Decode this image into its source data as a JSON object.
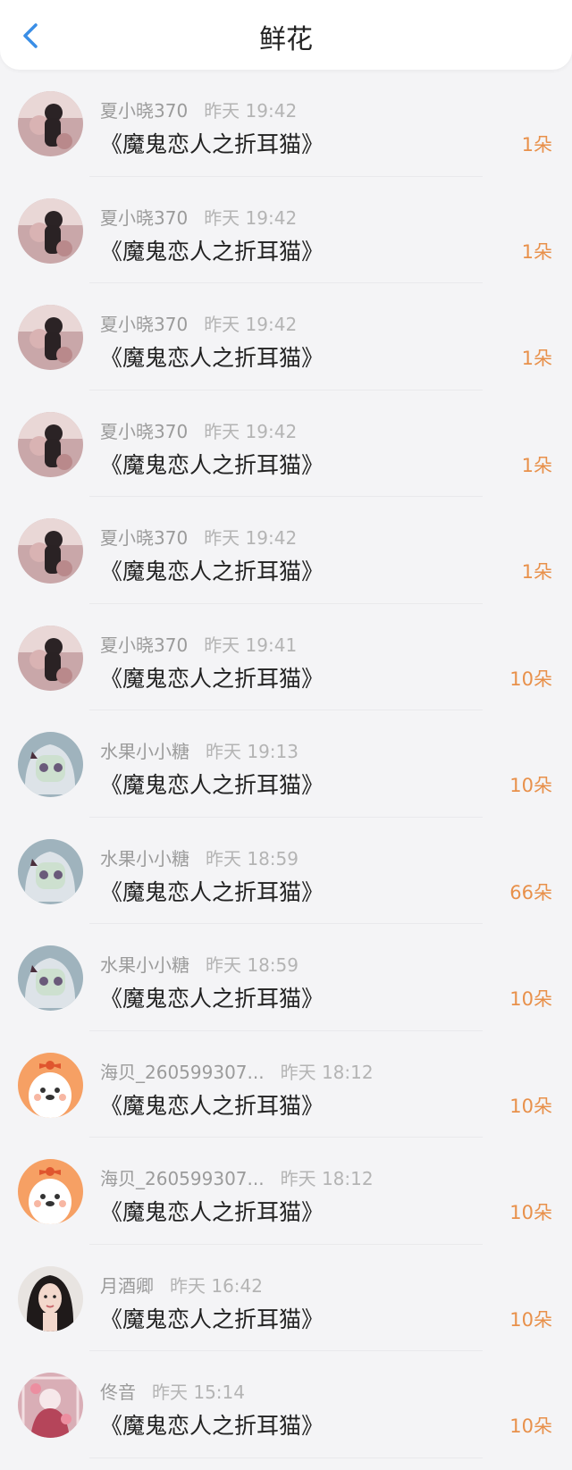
{
  "header": {
    "title": "鲜花"
  },
  "items": [
    {
      "user": "夏小晓370",
      "time": "昨天 19:42",
      "book": "《魔鬼恋人之折耳猫》",
      "count": "1朵"
    },
    {
      "user": "夏小晓370",
      "time": "昨天 19:42",
      "book": "《魔鬼恋人之折耳猫》",
      "count": "1朵"
    },
    {
      "user": "夏小晓370",
      "time": "昨天 19:42",
      "book": "《魔鬼恋人之折耳猫》",
      "count": "1朵"
    },
    {
      "user": "夏小晓370",
      "time": "昨天 19:42",
      "book": "《魔鬼恋人之折耳猫》",
      "count": "1朵"
    },
    {
      "user": "夏小晓370",
      "time": "昨天 19:42",
      "book": "《魔鬼恋人之折耳猫》",
      "count": "1朵"
    },
    {
      "user": "夏小晓370",
      "time": "昨天 19:41",
      "book": "《魔鬼恋人之折耳猫》",
      "count": "10朵"
    },
    {
      "user": "水果小小糖",
      "time": "昨天 19:13",
      "book": "《魔鬼恋人之折耳猫》",
      "count": "10朵"
    },
    {
      "user": "水果小小糖",
      "time": "昨天 18:59",
      "book": "《魔鬼恋人之折耳猫》",
      "count": "66朵"
    },
    {
      "user": "水果小小糖",
      "time": "昨天 18:59",
      "book": "《魔鬼恋人之折耳猫》",
      "count": "10朵"
    },
    {
      "user": "海贝_260599307...",
      "time": "昨天 18:12",
      "book": "《魔鬼恋人之折耳猫》",
      "count": "10朵"
    },
    {
      "user": "海贝_260599307...",
      "time": "昨天 18:12",
      "book": "《魔鬼恋人之折耳猫》",
      "count": "10朵"
    },
    {
      "user": "月酒卿",
      "time": "昨天 16:42",
      "book": "《魔鬼恋人之折耳猫》",
      "count": "10朵"
    },
    {
      "user": "佟音",
      "time": "昨天 15:14",
      "book": "《魔鬼恋人之折耳猫》",
      "count": "10朵"
    }
  ],
  "colors": {
    "accent": "#3a8ee6",
    "count": "#e8904a"
  }
}
